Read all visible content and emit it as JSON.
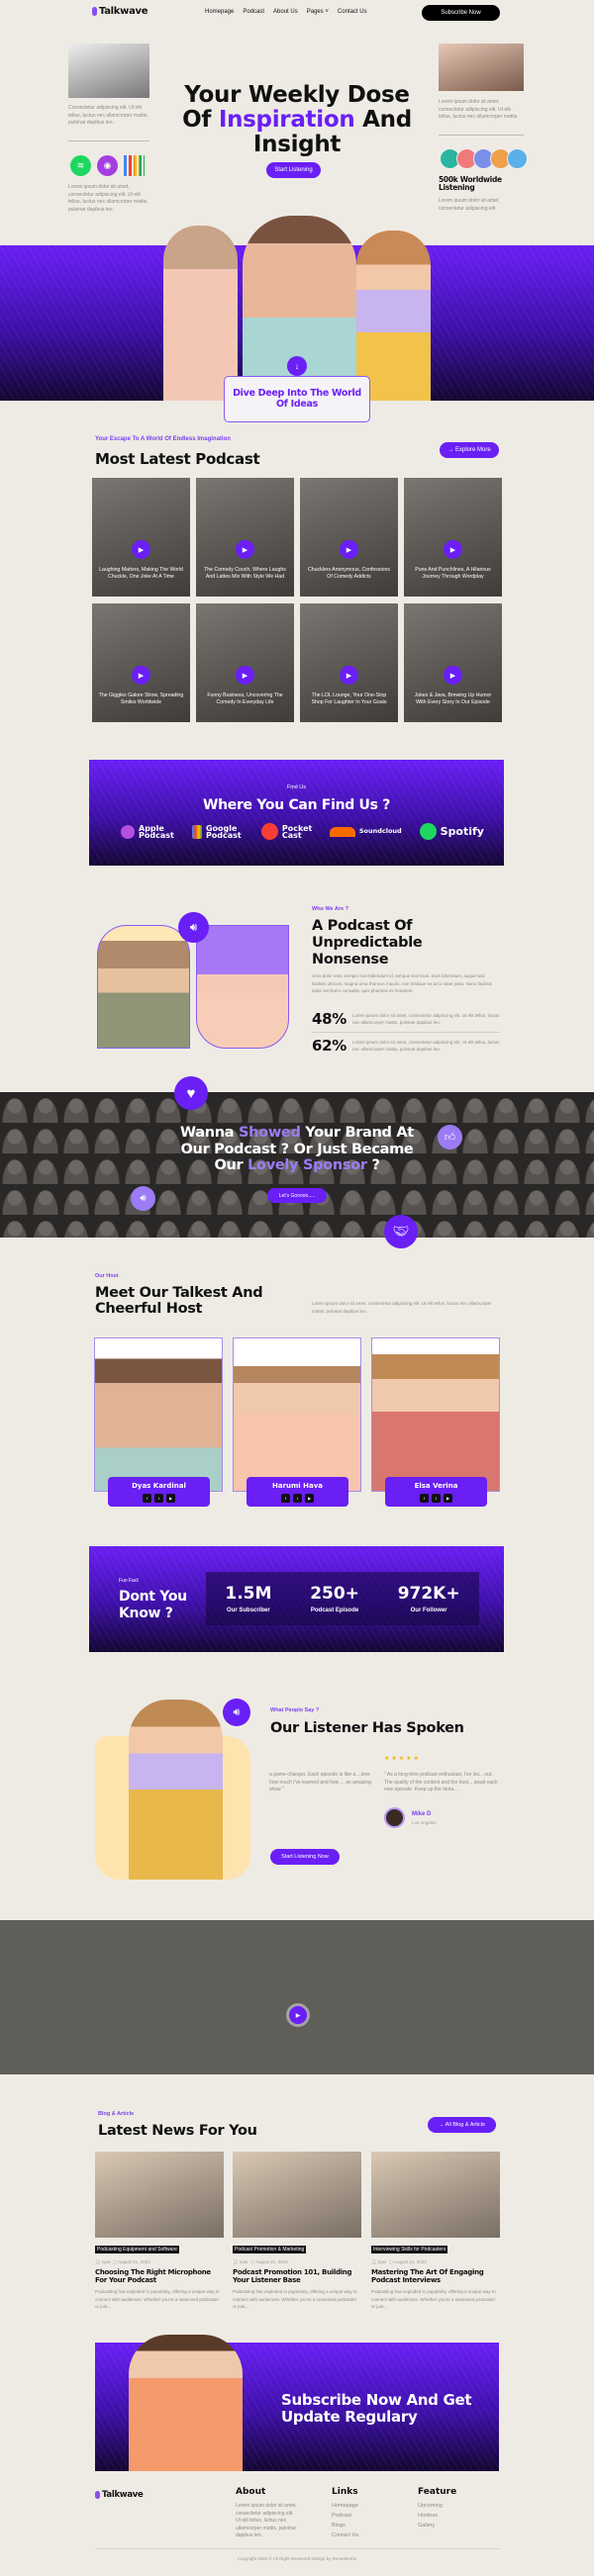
{
  "nav": {
    "logo": "Talkwave",
    "items": [
      "Homepage",
      "Podcast",
      "About Us",
      "Pages",
      "Contact Us"
    ],
    "subscribe": "Subscribe Now"
  },
  "hero": {
    "title_a": "Your Weekly Dose",
    "title_b": "Of ",
    "title_accent": "Inspiration",
    "title_c": " And",
    "title_d": "Insight",
    "cta": "Start Listening",
    "left_text1": "Consectetur adipiscing elit. Ut elit tellus, luctus nec ullamcorper mattis, pulvinar dapibus leo.",
    "left_text2": "Lorem ipsum dolor sit amet, consectetur adipiscing elit. Ut elit tellus, luctus nec ullamcorper mattis, pulvinar dapibus leo.",
    "right_text1": "Lorem ipsum dolor sit amet, consectetur adipiscing elit. Ut elit tellus, luctus nec ullamcorper mattis.",
    "listening": "500k Worldwide Listening",
    "right_text2": "Lorem ipsum dolor sit amet, consectetur adipiscing elit",
    "dive": "Dive Deep Into The World Of Ideas"
  },
  "latest": {
    "tag": "Your Escape To A World Of Endless Imagination",
    "title": "Most Latest Podcast",
    "button": "→ Explore More",
    "cards": [
      "Laughing Matters, Making The World Chuckle, One Joke At A Time",
      "The Comedy Couch, Where Laughs And Lattes Mix With Style We Had",
      "Chucklers Anonymous, Confessions Of Comedy Addicts",
      "Puns And Punchlines, A Hilarious Journey Through Wordplay",
      "The Giggles Galore Show, Spreading Smiles Worldwide",
      "Funny Business, Uncovering The Comedy In Everyday Life",
      "The LOL Lounge, Your One-Stop Shop For Laughter In Your Goals",
      "Jokes & Java, Brewing Up Humor With Every Story In Our Episode"
    ]
  },
  "find": {
    "tag": "Find Us",
    "title": "Where You Can Find Us ?",
    "platforms": [
      {
        "name": "Apple Podcast",
        "color": "#b44fe0"
      },
      {
        "name": "Google Podcast",
        "color": "#f2b400"
      },
      {
        "name": "Pocket Cast",
        "color": "#f43e37"
      },
      {
        "name": "Soundcloud",
        "color": "#ff6a00"
      },
      {
        "name": "Spotify",
        "color": "#1ed760"
      }
    ]
  },
  "about": {
    "tag": "Who We Are ?",
    "title": "A Podcast Of Unpredictable Nonsense",
    "text": "Cras dolor erat, semper non bibendum id, tempus sed risus. Duis bibendum, augue sed facilisis ultrices, magna urna rhoncus mauris, non tristique ex arcu vitae justo. Nunc facilisis dolor vel libero convallis, quis pharetra mi hendrerit.",
    "stats": [
      {
        "value": "48%",
        "text": "Lorem ipsum dolor sit amet, consectetur adipiscing elit. Ut elit tellus, luctus nec ullamcorper mattis, pulvinar dapibus leo."
      },
      {
        "value": "62%",
        "text": "Lorem ipsum dolor sit amet, consectetur adipiscing elit. Ut elit tellus, luctus nec ullamcorper mattis, pulvinar dapibus leo."
      }
    ]
  },
  "sponsor": {
    "t1": "Wanna ",
    "t1a": "Showed",
    "t1b": " Your Brand At",
    "t2": "Our Podcast ? Or Just Became",
    "t3": "Our ",
    "t3a": "Lovely Sponsor",
    "t3b": " ?",
    "button": "Let's Gooooo....."
  },
  "hosts": {
    "tag": "Our Host",
    "title": "Meet Our Talkest And Cheerful Host",
    "text": "Lorem ipsum dolor sit amet, consectetur adipiscing elit. Ut elit tellus, luctus nec ullamcorper mattis, pulvinar dapibus leo.",
    "people": [
      {
        "name": "Dyas Kardinal"
      },
      {
        "name": "Harumi Hava"
      },
      {
        "name": "Elsa Verina"
      }
    ]
  },
  "funfact": {
    "tag": "Fun Fact",
    "title": "Dont You Know ?",
    "stats": [
      {
        "value": "1.5M",
        "label": "Our Subscriber"
      },
      {
        "value": "250+",
        "label": "Podcast Episode"
      },
      {
        "value": "972K+",
        "label": "Our Follower"
      }
    ]
  },
  "testimonials": {
    "tag": "What People Say ?",
    "title": "Our Listener Has Spoken",
    "rating": 5,
    "quote1": "a game-changer. Each episode is like a ...ieve how much I've learned and how ... an amazing show \"",
    "quote2": "\" As a long-time podcast enthusiast, I've list... out. The quality of the content and the host... await each new episode. Keep up the fanta...",
    "author": "Mike D",
    "location": "Los Angeles",
    "button": "Start Listening Now"
  },
  "blog": {
    "tag": "Blog & Article",
    "title": "Latest News For You",
    "button": "→ All Blog & Article",
    "posts": [
      {
        "category": "Podcasting Equipment and Software",
        "author": "tyas",
        "date": "August 21, 2023",
        "title": "Choosing The Right Microphone For Your Podcast",
        "excerpt": "Podcasting has exploded in popularity, offering a unique way to connect with audiences. Whether you're a seasoned podcaster or just..."
      },
      {
        "category": "Podcast Promotion & Marketing",
        "author": "tyas",
        "date": "August 21, 2023",
        "title": "Podcast Promotion 101, Building Your Listener Base",
        "excerpt": "Podcasting has exploded in popularity, offering a unique way to connect with audiences. Whether you're a seasoned podcaster or just..."
      },
      {
        "category": "Interviewing Skills for Podcasters",
        "author": "tyas",
        "date": "August 21, 2023",
        "title": "Mastering The Art Of Engaging Podcast Interviews",
        "excerpt": "Podcasting has exploded in popularity, offering a unique way to connect with audiences. Whether you're a seasoned podcaster or just..."
      }
    ]
  },
  "subscribe": {
    "title": "Subscribe Now And Get Update Regulary"
  },
  "footer": {
    "logo": "Talkwave",
    "about_h": "About",
    "about": "Lorem ipsum dolor sit amet, consectetur adipiscing elit. Ut elit tellus, luctus nec ullamcorper mattis, pulvinar dapibus leo.",
    "links_h": "Links",
    "links": [
      "Homepage",
      "Podcast",
      "Blogs",
      "Contact Us"
    ],
    "feature_h": "Feature",
    "features": [
      "Upcoming",
      "Hostess",
      "Gallery"
    ],
    "copyright": "Copyright 2023 © All Right Reserved Design by Rometheme"
  },
  "colors": {
    "accent": "#6a1ff5",
    "background": "#eeebe5"
  }
}
